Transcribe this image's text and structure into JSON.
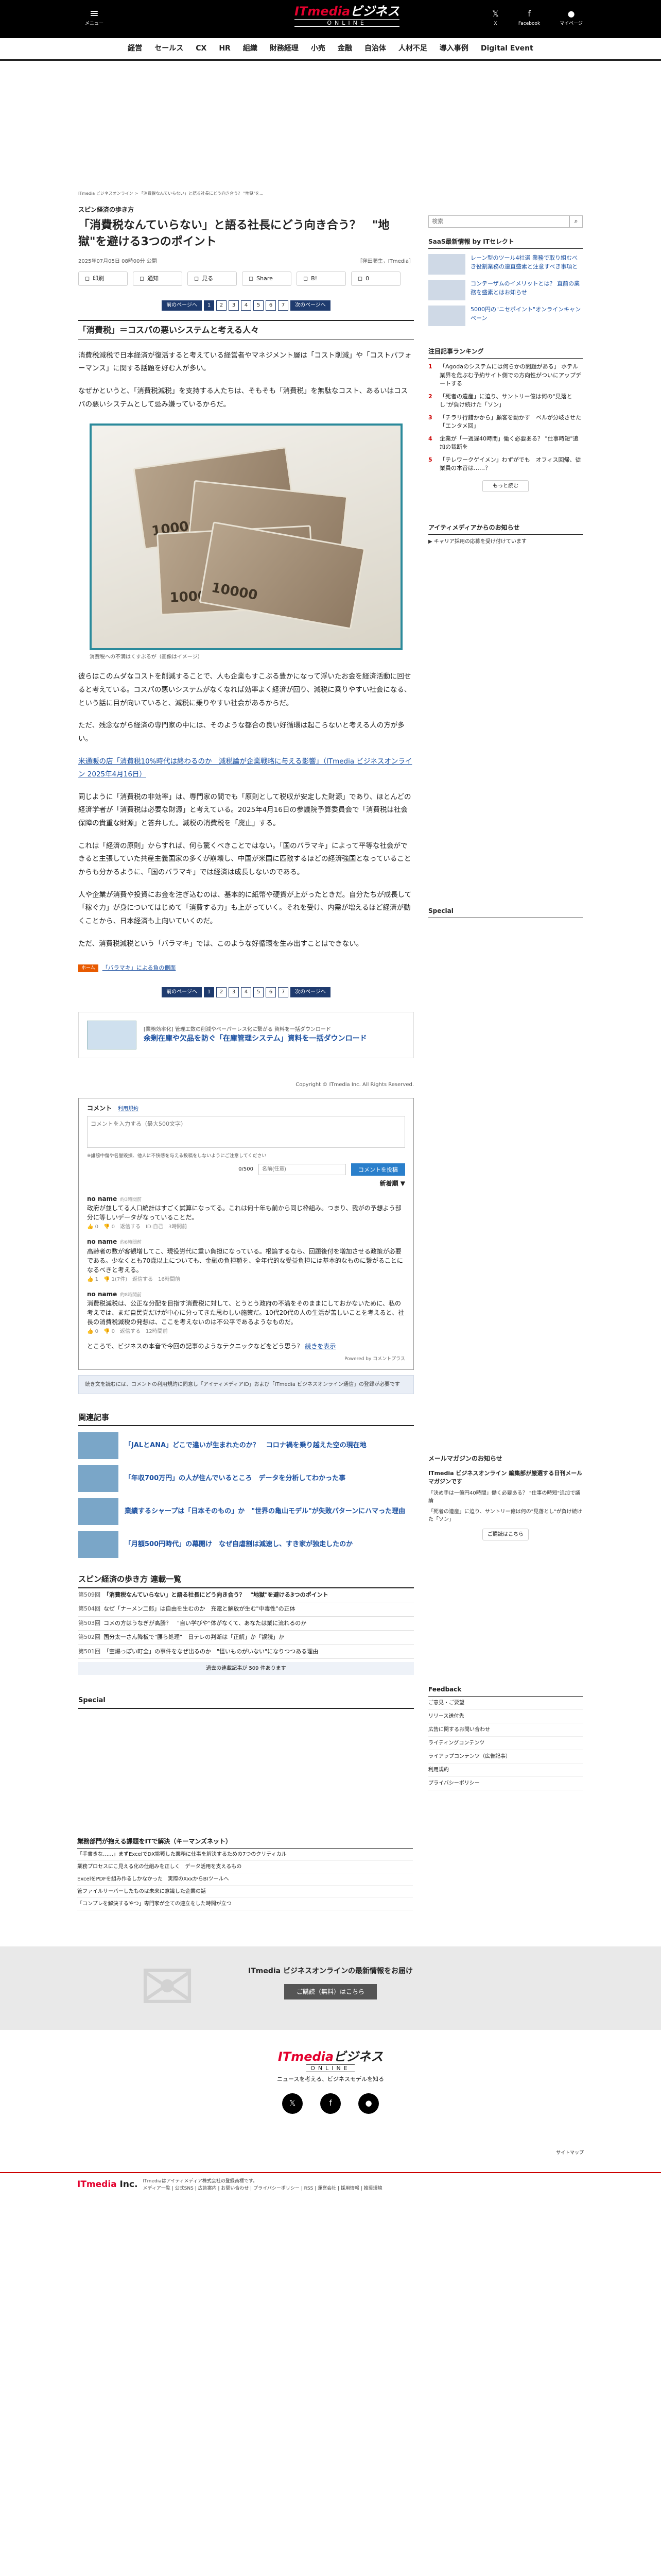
{
  "header": {
    "menu_label": "メニュー",
    "logo_line1_it": "ITmedia",
    "logo_line1_rest": "ビジネス",
    "logo_line2": "ONLINE",
    "icons": [
      {
        "name": "x-icon",
        "glyph": "𝕏",
        "label": "X"
      },
      {
        "name": "facebook-icon",
        "glyph": "f",
        "label": "Facebook"
      },
      {
        "name": "member-icon",
        "glyph": "●",
        "label": "マイページ"
      }
    ]
  },
  "nav": [
    "経営",
    "セールス",
    "CX",
    "HR",
    "組織",
    "財務経理",
    "小売",
    "金融",
    "自治体",
    "人材不足",
    "導入事例",
    "Digital Event"
  ],
  "article": {
    "breadcrumb": "ITmedia ビジネスオンライン > 「消費税なんていらない」と語る社長にどう向き合う？ \"地獄\"を...",
    "category": "スピン経済の歩き方",
    "title": "「消費税なんていらない」と語る社長にどう向き合う？　\"地獄\"を避ける3つのポイント",
    "date": "2025年07月05日 08時00分 公開",
    "author": "［窪田順生，ITmedia］",
    "share": [
      {
        "icon": "print-icon",
        "label": "印刷"
      },
      {
        "icon": "notify-icon",
        "label": "通知"
      },
      {
        "icon": "x-icon",
        "label": "見る"
      },
      {
        "icon": "facebook-icon",
        "label": "Share"
      },
      {
        "icon": "hatena-icon",
        "label": "B!"
      },
      {
        "icon": "pocket-icon",
        "label": "0"
      }
    ],
    "pager": {
      "prev": "前のページへ",
      "next": "次のページへ",
      "pages": [
        "1",
        "2",
        "3",
        "4",
        "5",
        "6",
        "7"
      ],
      "current": "1"
    },
    "section_heading": "「消費税」＝コスパの悪いシステムと考える人々",
    "paragraphs": [
      "消費税減税で日本経済が復活すると考えている経営者やマネジメント層は「コスト削減」や「コストパフォーマンス」に関する話題を好む人が多い。",
      "なぜかというと、「消費税減税」を支持する人たちは、そもそも「消費税」を無駄なコスト、あるいはコスパの悪いシステムとして忌み嫌っているからだ。"
    ],
    "caption": "消費税への不満はくすぶるが（画像はイメージ）",
    "paragraphs2": [
      "彼らはこのムダなコストを削減することで、人も企業もすこぶる豊かになって浮いたお金を経済活動に回せると考えている。コスパの悪いシステムがなくなれば効率よく経済が回り、減税に乗りやすい社会になる、という話に目が向いていると、減税に乗りやすい社会があるからだ。",
      "ただ、残念ながら経済の専門家の中には、そのような都合の良い好循環は起こらないと考える人の方が多い。",
      "同じように「消費税の非効率」は、専門家の間でも「原則として税収が安定した財源」であり、ほとんどの経済学者が「消費税は必要な財源」と考えている。2025年4月16日の参議院予算委員会で「消費税は社会保障の貴重な財源」と答弁した。減税の消費税を「廃止」する。",
      "これは「経済の原則」からすれば、何ら驚くべきことではない。「国のバラマキ」によって平等な社会ができると主張していた共産主義国家の多くが崩壊し、中国が米国に匹敵するほどの経済強国となっていることからも分かるように、「国のバラマキ」では経済は成長しないのである。",
      "人や企業が消費や投資にお金を注ぎ込むのは、基本的に紙幣や硬貨が上がったときだ。自分たちが成長して「稼ぐ力」が身についてはじめて「消費する力」も上がっていく。それを受け、内需が増えるほど経済が動くことから、日本経済も上向いていくのだ。",
      "ただ、消費税減税という「バラマキ」では、このような好循環を生み出すことはできない。"
    ],
    "highlight_link": "米通販の店「消費税10%時代は終わるのか　減税論が企業戦略に与える影響」（ITmedia ビジネスオンライン 2025年4月16日）",
    "tag": "ホーム",
    "tag_link": "「バラマキ」による負の側面"
  },
  "promo": {
    "label": "[業務効率化] 管理工数の削減やペーパーレス化に繋がる 資料を一括ダウンロード",
    "title": "余剰在庫や欠品を防ぐ「在庫管理システム」資料を一括ダウンロード"
  },
  "copyright": "Copyright © ITmedia Inc. All Rights Reserved.",
  "comments": {
    "title": "コメント",
    "count_label": "利用規約",
    "placeholder": "コメントを入力する（最大500文字）",
    "policy": "※誹謗中傷や名誉毀損、他人に不快感を与える投稿をしないようにご注意してください",
    "counter": "0/500",
    "nick_placeholder": "名前(任意)",
    "submit": "コメントを投稿",
    "sort": "新着順 ▼",
    "items": [
      {
        "who": "no name",
        "when": "約3時間前",
        "text": "政府が並してる人口統計はすごく試算になってる。これは何十年も前から同じ枠組み。つまり、我がの予想よう部分に等しいデータがなっていることだ。",
        "stats": "👍 0　👎 0　返信する　ID:自己　3時間前"
      },
      {
        "who": "no name",
        "when": "約6時間前",
        "text": "高齢者の数が客観増してこ、現役労代に重い負担になっている。根論するなら、回題後付を増加させる政策が必要である。少なくとも70歳以上についても、金融の負担額を、全年代的な受益負担には基本的なものに繋がることになるべきと考える。",
        "stats": "👍 1　👎 1(7件)　返信する　16時間前"
      },
      {
        "who": "no name",
        "when": "約8時間前",
        "text": "消費税減税は、公正な分配を目指す消費税に対して、とうとう政府の不満をそのままにしておかないために、私の考えでは、まだ自民党だけが中心に分ってきた思わしい施策だ。10代20代の人の生活が苦しいことを考えると、社長の消費税減税の発想は、ここを考えないのは不公平であるようなものだ。",
        "stats": "👍 0　👎 0　返信する　12時間前"
      }
    ],
    "more": "ところで、ビジネスの本音で今回の記事のようなテクニックなどをどう思う？",
    "more_link": "続きを表示",
    "powered": "Powered by コメントプラス",
    "notice": "続き文を読むには、コメントの利用規約に同意し「アイティメディアID」および「ITmedia ビジネスオンライン通信」の登録が必要です"
  },
  "related": {
    "heading": "関連記事",
    "items": [
      "「JALとANA」どこで違いが生まれたのか？　コロナ禍を乗り越えた空の現在地",
      "「年収700万円」の人が住んでいるところ　データを分析してわかった事",
      "業績するシャープは「日本そのもの」か　\"世界の亀山モデル\"が失敗パターンにハマった理由",
      "「月額500円時代」の幕開け　なぜ自虐割は減速し、すき家が独走したのか"
    ]
  },
  "series": {
    "heading": "スピン経済の歩き方 連載一覧",
    "items": [
      {
        "ep": "第509回",
        "title": "「消費税なんていらない」と語る社長にどう向き合う？　\"地獄\"を避ける3つのポイント",
        "current": true
      },
      {
        "ep": "第504回",
        "title": "なぜ「ナーメン二郎」は自由を生むのか　充電と解放が生む\"中毒性\"の正体",
        "current": false
      },
      {
        "ep": "第503回",
        "title": "コメの方はうなぎが高騰？　\"自い学びや\"体がなくて、あなたは業に流れるのか",
        "current": false
      },
      {
        "ep": "第502回",
        "title": "国分太一さん降板で\"腰ら処理\"　日テレの判断は「正解」か「誤読」か",
        "current": false
      },
      {
        "ep": "第501回",
        "title": "「空爆っぽい町全」の事件をなぜ出るのか　\"怪いものがいない\"になりつつある理由",
        "current": false
      }
    ],
    "more": "過去の連載記事が 509 件あります"
  },
  "special_heading": "Special",
  "sidebar": {
    "search_placeholder": "検索",
    "saas_heading": "SaaS最新情報 by ITセレクト",
    "saas_items": [
      "レーン型のツール4社選 業務で取り組むべき役割業務の連直盛素と注意すべき事項と",
      "コンテーザムのイメリットとは？ 直前の業務を盛素とはお知らせ",
      "5000円の\"ニセポイント\"オンラインキャンペーン"
    ],
    "ranking_heading": "注目記事ランキング",
    "ranking": [
      "「Agodaのシステムには何らかの問題がある」 ホテル業界を危ぶむ予約サイト側での方向性がついにアップデートする",
      "「死者の遺産」に迫り、サントリー億は何の\"見落とし\"が負け続けた「ソン」",
      "「チラリ行錯かから」顧客を動かす　ベルが分岐させた「エンタメ回」",
      "企業が「一週遅40時間」働く必要ある？ \"仕事時短\"追加の裁断を",
      "「テレワークゲイメン」わずがでも　オフィス回帰、従業員の本音は……？"
    ],
    "ranking_more": "もっと読む",
    "idea_heading": "アイティメディアからのお知らせ",
    "idea_text": "▶ キャリア採用の応募を受け付けています",
    "special_heading": "Special",
    "mail_heading": "メールマガジンのお知らせ",
    "mail_title": "ITmedia ビジネスオンライン 編集部が厳選する日刊メールマガジンです",
    "mail_items": [
      "「決め手は一億円40時間」働く必要ある？ \"仕事の時短\"追加で議論",
      "「死者の遺産」に迫り、サントリー億は何の\"見落とし\"が負け続けた「ソン」"
    ],
    "mail_button": "ご購読はこちら",
    "feedback_heading": "Feedback",
    "feedback": [
      "ご意見・ご要望",
      "リリース送付先",
      "広告に関するお問い合わせ",
      "ライティングコンテンツ",
      "ライアップコンテンツ（広告記事）",
      "利用規約",
      "プライバシーポリシー"
    ]
  },
  "bottom_list": {
    "heading": "業務部門が抱える課題をITで解決（キーマンズネット）",
    "items": [
      "「手書きな……」まずExcelでDX挑戦した業務に仕事を解決するための7つのクリティカル",
      "業務プロセスにこ見える化の仕組みを正しく　データ活用を支えるもの",
      "ExcelをPDFを組み作るしかなかった　実際のXxxからBIツールへ",
      "管ファイルサーバーしたものは未来に意識した企業の話",
      "「コンプレを解決するやつ」専門家が全ての連立をした時間が立つ"
    ]
  },
  "mailband": {
    "title": "ITmedia ビジネスオンラインの最新情報をお届け",
    "button": "ご購読（無料）はこちら"
  },
  "footer": {
    "tagline": "ニュースを考える、ビジネスモデルを知る",
    "sitemap": "サイトマップ",
    "corp_it": "ITmedia",
    "corp_rest": " Inc.",
    "corp_text1": "ITmediaはアイティメディア株式会社の登録商標です。",
    "corp_text2": "メディア一覧 | 公式SNS | 広告案内 | お問い合わせ | プライバシーポリシー | RSS | 運営会社 | 採用情報 | 推奨環境"
  }
}
